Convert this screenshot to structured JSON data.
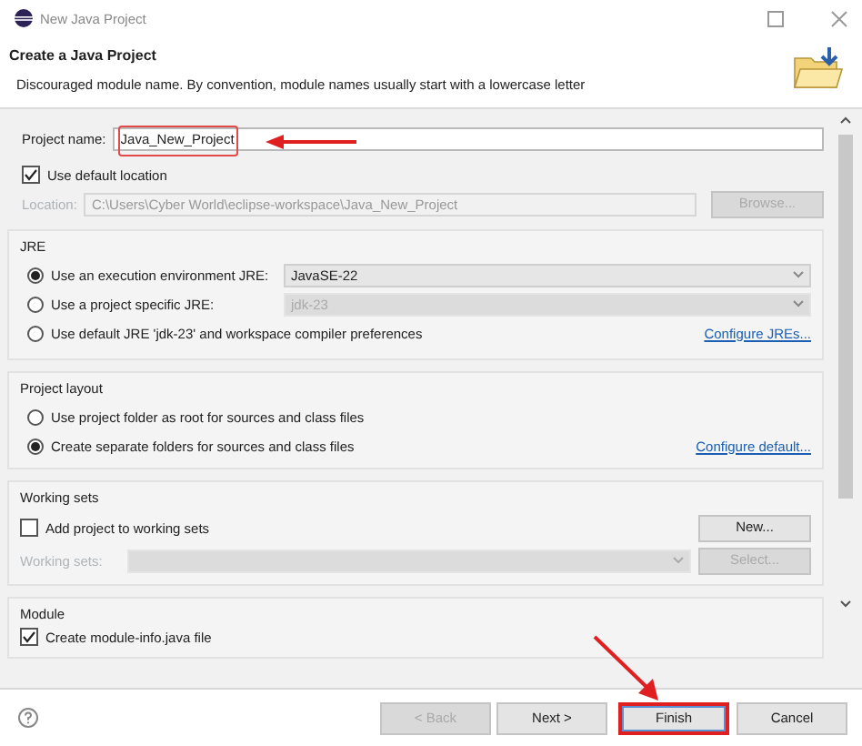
{
  "window": {
    "title": "New Java Project"
  },
  "header": {
    "title": "Create a Java Project",
    "message": "Discouraged module name. By convention, module names usually start with a lowercase letter"
  },
  "project_name": {
    "label": "Project name:",
    "value": "Java_New_Project",
    "annotated": true
  },
  "use_default_location": {
    "label": "Use default location",
    "checked": true
  },
  "location": {
    "label": "Location:",
    "value": "C:\\Users\\Cyber World\\eclipse-workspace\\Java_New_Project",
    "disabled": true,
    "button": {
      "label": "Browse...",
      "disabled": true
    }
  },
  "jre": {
    "title": "JRE",
    "options": [
      {
        "label": "Use an execution environment JRE:",
        "selected": true,
        "combo": {
          "value": "JavaSE-22",
          "disabled": false
        }
      },
      {
        "label": "Use a project specific JRE:",
        "selected": false,
        "combo": {
          "value": "jdk-23",
          "disabled": true
        }
      },
      {
        "label": "Use default JRE 'jdk-23' and workspace compiler preferences",
        "selected": false,
        "link": "Configure JREs..."
      }
    ]
  },
  "project_layout": {
    "title": "Project layout",
    "options": [
      {
        "label": "Use project folder as root for sources and class files",
        "selected": false
      },
      {
        "label": "Create separate folders for sources and class files",
        "selected": true,
        "link": "Configure default..."
      }
    ]
  },
  "working_sets": {
    "title": "Working sets",
    "add": {
      "label": "Add project to working sets",
      "checked": false
    },
    "new_button": {
      "label": "New...",
      "disabled": false
    },
    "field": {
      "label": "Working sets:",
      "disabled": true
    },
    "select_button": {
      "label": "Select...",
      "disabled": true
    }
  },
  "module": {
    "title": "Module",
    "create": {
      "label": "Create module-info.java file",
      "checked": true
    }
  },
  "buttons": [
    {
      "label": "< Back",
      "disabled": true,
      "annotated": false
    },
    {
      "label": "Next >",
      "disabled": false,
      "annotated": false
    },
    {
      "label": "Finish",
      "disabled": false,
      "annotated": true
    },
    {
      "label": "Cancel",
      "disabled": false,
      "annotated": false
    }
  ]
}
